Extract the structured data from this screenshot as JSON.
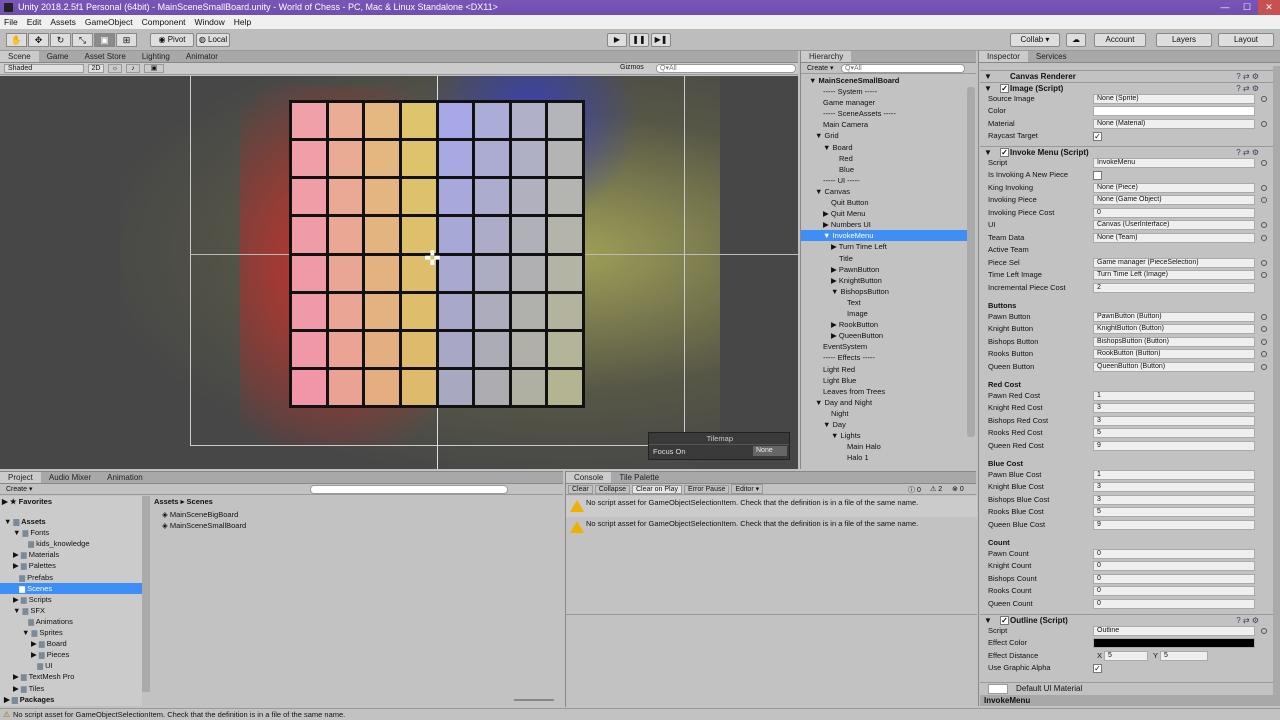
{
  "title": "Unity 2018.2.5f1 Personal (64bit) - MainSceneSmallBoard.unity - World of Chess - PC, Mac & Linux Standalone <DX11>",
  "window_controls": [
    "—",
    "☐",
    "✕"
  ],
  "menu": [
    "File",
    "Edit",
    "Assets",
    "GameObject",
    "Component",
    "Window",
    "Help"
  ],
  "toolbar": {
    "pivot": "Pivot",
    "local": "Local",
    "collab": "Collab ▾",
    "account": "Account",
    "layers": "Layers",
    "layout": "Layout"
  },
  "scene": {
    "tabs": [
      "Scene",
      "Game",
      "Asset Store",
      "Lighting",
      "Animator"
    ],
    "shading": "Shaded",
    "mode2d": "2D",
    "gizmos": "Gizmos",
    "search": "Q▾All",
    "tilemap_title": "Tilemap",
    "focus_label": "Focus On",
    "focus_value": "None"
  },
  "hierarchy": {
    "tab": "Hierarchy",
    "create": "Create ▾",
    "search": "Q▾All",
    "scene": "MainSceneSmallBoard",
    "items": [
      {
        "t": "----- System -----",
        "d": 1
      },
      {
        "t": "Game manager",
        "d": 1
      },
      {
        "t": "----- SceneAssets -----",
        "d": 1
      },
      {
        "t": "Main Camera",
        "d": 1
      },
      {
        "t": "Grid",
        "d": 1,
        "a": "▼"
      },
      {
        "t": "Board",
        "d": 2,
        "a": "▼"
      },
      {
        "t": "Red",
        "d": 3
      },
      {
        "t": "Blue",
        "d": 3
      },
      {
        "t": "----- UI -----",
        "d": 1
      },
      {
        "t": "Canvas",
        "d": 1,
        "a": "▼"
      },
      {
        "t": "Quit Button",
        "d": 2
      },
      {
        "t": "Quit Menu",
        "d": 2,
        "a": "▶"
      },
      {
        "t": "Numbers UI",
        "d": 2,
        "a": "▶"
      },
      {
        "t": "InvokeMenu",
        "d": 2,
        "a": "▼",
        "s": true
      },
      {
        "t": "Turn Time Left",
        "d": 3,
        "a": "▶"
      },
      {
        "t": "Title",
        "d": 3
      },
      {
        "t": "PawnButton",
        "d": 3,
        "a": "▶"
      },
      {
        "t": "KnightButton",
        "d": 3,
        "a": "▶"
      },
      {
        "t": "BishopsButton",
        "d": 3,
        "a": "▼"
      },
      {
        "t": "Text",
        "d": 4
      },
      {
        "t": "Image",
        "d": 4
      },
      {
        "t": "RookButton",
        "d": 3,
        "a": "▶"
      },
      {
        "t": "QueenButton",
        "d": 3,
        "a": "▶"
      },
      {
        "t": "EventSystem",
        "d": 1
      },
      {
        "t": "----- Effects -----",
        "d": 1
      },
      {
        "t": "Light Red",
        "d": 1
      },
      {
        "t": "Light Blue",
        "d": 1
      },
      {
        "t": "Leaves from Trees",
        "d": 1
      },
      {
        "t": "Day and Night",
        "d": 1,
        "a": "▼"
      },
      {
        "t": "Night",
        "d": 2
      },
      {
        "t": "Day",
        "d": 2,
        "a": "▼"
      },
      {
        "t": "Lights",
        "d": 3,
        "a": "▼"
      },
      {
        "t": "Main Halo",
        "d": 4
      },
      {
        "t": "Halo 1",
        "d": 4
      }
    ]
  },
  "inspector": {
    "tabs": [
      "Inspector",
      "Services"
    ],
    "canvas_renderer": "Canvas Renderer",
    "image_script": "Image (Script)",
    "image_fields": [
      [
        "Source Image",
        "None (Sprite)"
      ],
      [
        "Color",
        ""
      ],
      [
        "Material",
        "None (Material)"
      ],
      [
        "Raycast Target",
        "✓"
      ]
    ],
    "invoke_script": "Invoke Menu (Script)",
    "invoke_fields": [
      [
        "Script",
        "InvokeMenu"
      ],
      [
        "Is Invoking A New Piece",
        ""
      ],
      [
        "King Invoking",
        "None (Piece)"
      ],
      [
        "Invoking Piece",
        "None (Game Object)"
      ],
      [
        "Invoking Piece Cost",
        "0"
      ],
      [
        "UI",
        "Canvas (UserInterface)"
      ],
      [
        "Team Data",
        "None (Team)"
      ],
      [
        "Active Team",
        ""
      ],
      [
        "Piece Sel",
        "Game manager (PieceSelection)"
      ],
      [
        "Time Left Image",
        "Turn Time Left (Image)"
      ],
      [
        "Incremental Piece Cost",
        "2"
      ]
    ],
    "buttons_header": "Buttons",
    "buttons": [
      [
        "Pawn Button",
        "PawnButton (Button)"
      ],
      [
        "Knight Button",
        "KnightButton (Button)"
      ],
      [
        "Bishops Button",
        "BishopsButton (Button)"
      ],
      [
        "Rooks Button",
        "RookButton (Button)"
      ],
      [
        "Queen Button",
        "QueenButton (Button)"
      ]
    ],
    "red_header": "Red Cost",
    "red": [
      [
        "Pawn Red Cost",
        "1"
      ],
      [
        "Knight Red Cost",
        "3"
      ],
      [
        "Bishops Red Cost",
        "3"
      ],
      [
        "Rooks Red Cost",
        "5"
      ],
      [
        "Queen Red Cost",
        "9"
      ]
    ],
    "blue_header": "Blue Cost",
    "blue": [
      [
        "Pawn Blue Cost",
        "1"
      ],
      [
        "Knight Blue Cost",
        "3"
      ],
      [
        "Bishops Blue Cost",
        "3"
      ],
      [
        "Rooks Blue Cost",
        "5"
      ],
      [
        "Queen Blue Cost",
        "9"
      ]
    ],
    "count_header": "Count",
    "count": [
      [
        "Pawn Count",
        "0"
      ],
      [
        "Knight Count",
        "0"
      ],
      [
        "Bishops Count",
        "0"
      ],
      [
        "Rooks Count",
        "0"
      ],
      [
        "Queen Count",
        "0"
      ]
    ],
    "outline_script": "Outline (Script)",
    "outline_fields": [
      [
        "Script",
        "Outline"
      ],
      [
        "Effect Color",
        ""
      ],
      [
        "Effect Distance",
        ""
      ],
      [
        "Use Graphic Alpha",
        "✓"
      ]
    ],
    "effect_x": "5",
    "effect_y": "5",
    "material": "Default UI Material",
    "footer": "InvokeMenu"
  },
  "project": {
    "tabs": [
      "Project",
      "Audio Mixer",
      "Animation"
    ],
    "create": "Create ▾",
    "breadcrumb": "Assets ▸ Scenes",
    "favorites": "Favorites",
    "tree": [
      {
        "t": "Assets",
        "d": 0,
        "a": "▼",
        "b": true
      },
      {
        "t": "Fonts",
        "d": 1,
        "a": "▼"
      },
      {
        "t": "kids_knowledge",
        "d": 2
      },
      {
        "t": "Materials",
        "d": 1,
        "a": "▶"
      },
      {
        "t": "Palettes",
        "d": 1,
        "a": "▶"
      },
      {
        "t": "Prefabs",
        "d": 1
      },
      {
        "t": "Scenes",
        "d": 1,
        "s": true
      },
      {
        "t": "Scripts",
        "d": 1,
        "a": "▶"
      },
      {
        "t": "SFX",
        "d": 1,
        "a": "▼"
      },
      {
        "t": "Animations",
        "d": 2
      },
      {
        "t": "Sprites",
        "d": 2,
        "a": "▼"
      },
      {
        "t": "Board",
        "d": 3,
        "a": "▶"
      },
      {
        "t": "Pieces",
        "d": 3,
        "a": "▶"
      },
      {
        "t": "UI",
        "d": 3
      },
      {
        "t": "TextMesh Pro",
        "d": 1,
        "a": "▶"
      },
      {
        "t": "Tiles",
        "d": 1,
        "a": "▶"
      },
      {
        "t": "Packages",
        "d": 0,
        "a": "▶",
        "b": true
      }
    ],
    "files": [
      "MainSceneBigBoard",
      "MainSceneSmallBoard"
    ]
  },
  "console": {
    "tabs": [
      "Console",
      "Tile Palette"
    ],
    "buttons": [
      "Clear",
      "Collapse",
      "Clear on Play",
      "Error Pause",
      "Editor ▾"
    ],
    "counts": [
      "0",
      "2",
      "0"
    ],
    "messages": [
      "No script asset for GameObjectSelectionItem. Check that the definition is in a file of the same name.",
      "No script asset for GameObjectSelectionItem. Check that the definition is in a file of the same name."
    ]
  },
  "status": "No script asset for GameObjectSelectionItem. Check that the definition is in a file of the same name.",
  "colors": {
    "title_bar": "#7352b4",
    "selection": "#3d8ff7",
    "board_red": "#f0a0a8",
    "board_blue": "#a8a8e8"
  }
}
